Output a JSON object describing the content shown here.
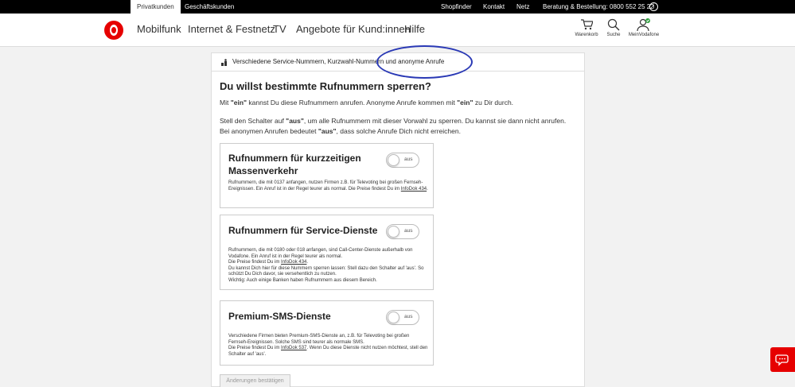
{
  "topbar": {
    "tab_private": "Privatkunden",
    "tab_business": "Geschäftskunden",
    "shopfinder": "Shopfinder",
    "contact": "Kontakt",
    "network": "Netz",
    "hotline": "Beratung & Bestellung: 0800 552 25 22",
    "info_symbol": "i"
  },
  "nav": {
    "items": [
      "Mobilfunk",
      "Internet & Festnetz",
      "TV",
      "Angebote für Kund:innen",
      "Hilfe"
    ],
    "cart": "Warenkorb",
    "search": "Suche",
    "account": "MeinVodafone"
  },
  "breadcrumb": "Verschiedene Service-Nummern, Kurzwahl-Nummern und anonyme Anrufe",
  "main": {
    "title": "Du willst bestimmte Rufnummern sperren?",
    "intro1_a": "Mit ",
    "intro1_b": "\"ein\"",
    "intro1_c": " kannst Du diese Rufnummern anrufen. Anonyme Anrufe kommen mit ",
    "intro1_d": "\"ein\"",
    "intro1_e": " zu Dir durch.",
    "intro2_a": "Stell den Schalter auf ",
    "intro2_b": "\"aus\"",
    "intro2_c": ", um alle Rufnummern mit dieser Vorwahl zu sperren. Du kannst sie dann nicht anrufen. Bei anonymen Anrufen bedeutet ",
    "intro2_d": "\"aus\"",
    "intro2_e": ", dass solche Anrufe Dich nicht erreichen.",
    "confirm_button": "Änderungen bestätigen"
  },
  "options": [
    {
      "title": "Rufnummern für kurzzeitigen Massenverkehr",
      "toggle": "aus",
      "text_a": "Rufnummern, die mit 0137 anfangen, nutzen Firmen z.B. für Televoting bei großen Fernseh-Ereignissen. Ein Anruf ist in der Regel teurer als normal. Die Preise findest Du im ",
      "link": "InfoDok 434",
      "text_b": "."
    },
    {
      "title": "Rufnummern für Service-Dienste",
      "toggle": "aus",
      "text_a": "Rufnummern, die mit 0180 oder 018 anfangen, sind Call-Center-Dienste außerhalb von Vodafone. Ein Anruf ist in der Regel teurer als normal.",
      "text_b": "Die Preise findest Du im ",
      "link": "InfoDok 434",
      "text_c": ".",
      "text_d": "Du kannst Dich hier für diese Nummern sperren lassen: Stell dazu den Schalter auf 'aus'. So schützt Du Dich davor, sie versehentlich zu nutzen.",
      "text_e": "Wichtig: Auch einige Banken haben Rufnummern aus diesem Bereich."
    },
    {
      "title": "Premium-SMS-Dienste",
      "toggle": "aus",
      "text_a": "Verschiedene Firmen bieten Premium-SMS-Dienste an, z.B. für Televoting bei großen Fernseh-Ereignissen. Solche SMS sind teurer als normale SMS.",
      "text_b": "Die Preise findest Du im ",
      "link": "InfoDok 537",
      "text_c": ". Wenn Du diese Dienste nicht nutzen möchtest, stell den Schalter auf 'aus'."
    }
  ],
  "colors": {
    "brand": "#e60000",
    "highlight": "#2a39b5"
  }
}
